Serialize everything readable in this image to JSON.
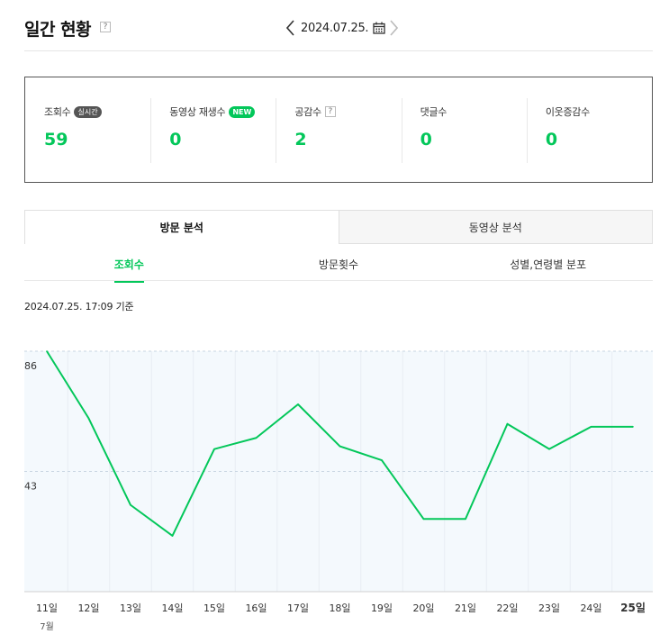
{
  "header": {
    "title": "일간 현황",
    "help": "?",
    "date": "2024.07.25."
  },
  "stats": [
    {
      "label": "조회수",
      "badge": "실시간",
      "badge_type": "live",
      "value": "59"
    },
    {
      "label": "동영상 재생수",
      "badge": "NEW",
      "badge_type": "new",
      "value": "0"
    },
    {
      "label": "공감수",
      "badge": "?",
      "badge_type": "help",
      "value": "2"
    },
    {
      "label": "댓글수",
      "badge": "",
      "badge_type": "none",
      "value": "0"
    },
    {
      "label": "이웃증감수",
      "badge": "",
      "badge_type": "none",
      "value": "0"
    }
  ],
  "main_tabs": [
    "방문 분석",
    "동영상 분석"
  ],
  "sub_tabs": [
    "조회수",
    "방문횟수",
    "성별,연령별 분포"
  ],
  "timestamp": "2024.07.25. 17:09 기준",
  "colors": {
    "accent": "#03c75a",
    "chart_bg": "#f4f9fd"
  },
  "chart_data": {
    "type": "line",
    "categories": [
      "11일",
      "12일",
      "13일",
      "14일",
      "15일",
      "16일",
      "17일",
      "18일",
      "19일",
      "20일",
      "21일",
      "22일",
      "23일",
      "24일",
      "25일"
    ],
    "month_label": "7월",
    "y_ticks": [
      86,
      43
    ],
    "ylim": [
      0,
      86
    ],
    "series": [
      {
        "values": [
          86,
          62,
          31,
          20,
          51,
          55,
          67,
          52,
          47,
          26,
          26,
          60,
          51,
          59,
          59
        ]
      }
    ],
    "grid": true
  }
}
